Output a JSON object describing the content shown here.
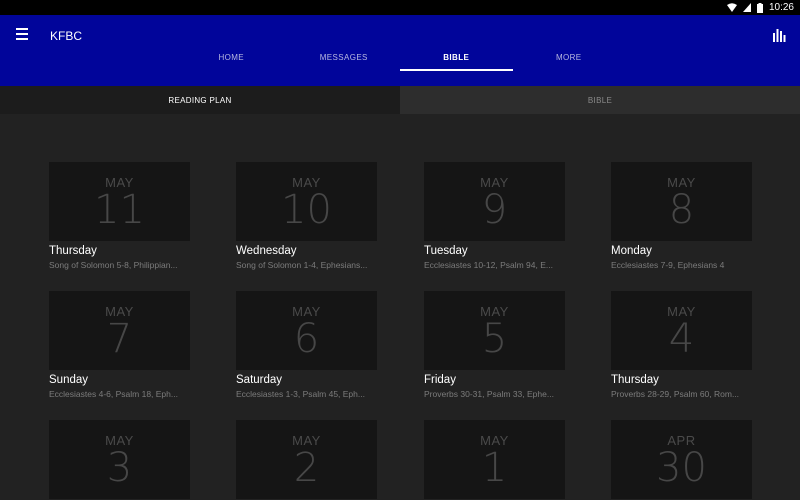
{
  "status": {
    "time": "10:26"
  },
  "app": {
    "title": "KFBC"
  },
  "tabs": [
    {
      "label": "HOME",
      "active": false
    },
    {
      "label": "MESSAGES",
      "active": false
    },
    {
      "label": "BIBLE",
      "active": true
    },
    {
      "label": "MORE",
      "active": false
    }
  ],
  "subtabs": [
    {
      "label": "READING PLAN",
      "active": true
    },
    {
      "label": "BIBLE",
      "active": false
    }
  ],
  "cards": [
    {
      "month": "MAY",
      "day": "11",
      "weekday": "Thursday",
      "reading": "Song of Solomon 5-8, Philippian..."
    },
    {
      "month": "MAY",
      "day": "10",
      "weekday": "Wednesday",
      "reading": "Song of Solomon 1-4, Ephesians..."
    },
    {
      "month": "MAY",
      "day": "9",
      "weekday": "Tuesday",
      "reading": "Ecclesiastes 10-12, Psalm 94, E..."
    },
    {
      "month": "MAY",
      "day": "8",
      "weekday": "Monday",
      "reading": "Ecclesiastes 7-9, Ephesians 4"
    },
    {
      "month": "MAY",
      "day": "7",
      "weekday": "Sunday",
      "reading": "Ecclesiastes 4-6, Psalm 18, Eph..."
    },
    {
      "month": "MAY",
      "day": "6",
      "weekday": "Saturday",
      "reading": "Ecclesiastes 1-3, Psalm 45, Eph..."
    },
    {
      "month": "MAY",
      "day": "5",
      "weekday": "Friday",
      "reading": "Proverbs 30-31, Psalm 33, Ephe..."
    },
    {
      "month": "MAY",
      "day": "4",
      "weekday": "Thursday",
      "reading": "Proverbs 28-29, Psalm 60, Rom..."
    },
    {
      "month": "MAY",
      "day": "3",
      "weekday": "",
      "reading": ""
    },
    {
      "month": "MAY",
      "day": "2",
      "weekday": "",
      "reading": ""
    },
    {
      "month": "MAY",
      "day": "1",
      "weekday": "",
      "reading": ""
    },
    {
      "month": "APR",
      "day": "30",
      "weekday": "",
      "reading": ""
    }
  ]
}
